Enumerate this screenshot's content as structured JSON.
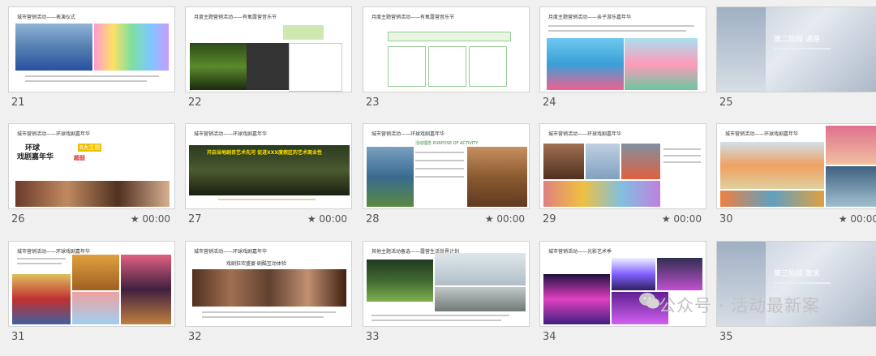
{
  "slides": [
    {
      "number": "21",
      "title": "城市营销活动——表演仪式",
      "duration": ""
    },
    {
      "number": "22",
      "title": "月度主题营销活动——有氧露营音乐节",
      "duration": ""
    },
    {
      "number": "23",
      "title": "月度主题营销活动——有氧露营音乐节",
      "duration": ""
    },
    {
      "number": "24",
      "title": "月度主题营销活动——亲子游乐嘉年华",
      "duration": ""
    },
    {
      "number": "25",
      "title": "第二阶段 通路",
      "duration": ""
    },
    {
      "number": "26",
      "title": "城市营销活动——环球戏剧嘉年华",
      "duration": "00:00"
    },
    {
      "number": "27",
      "title": "城市营销活动——环球戏剧嘉年华",
      "duration": "00:00"
    },
    {
      "number": "28",
      "title": "城市营销活动——环球戏剧嘉年华",
      "duration": "00:00"
    },
    {
      "number": "29",
      "title": "城市营销活动——环球戏剧嘉年华",
      "duration": "00:00"
    },
    {
      "number": "30",
      "title": "城市营销活动——环球戏剧嘉年华",
      "duration": "00:00"
    },
    {
      "number": "31",
      "title": "城市营销活动——环球戏剧嘉年华",
      "duration": ""
    },
    {
      "number": "32",
      "title": "城市营销活动——环球戏剧嘉年华",
      "duration": ""
    },
    {
      "number": "33",
      "title": "其他主题活动备选——露营生活世界计划",
      "duration": ""
    },
    {
      "number": "34",
      "title": "城市营销活动——光影艺术季",
      "duration": ""
    },
    {
      "number": "35",
      "title": "第三阶段 聚焦",
      "duration": ""
    }
  ],
  "slide26": {
    "headline1": "环球",
    "headline2": "戏剧嘉年华",
    "tag": "8大主题",
    "tag2": "超前"
  },
  "slide27": {
    "headline": "开启当地剧目艺术先河 促进XXX度假区的艺术商业性"
  },
  "slide28": {
    "subtitle": "活动理念 PURPOSE OF ACTIVITY"
  },
  "slide32": {
    "subtitle": "戏剧狂欢盛宴·剧酷互动体验"
  },
  "watermark": {
    "text": "公众号 · 活动最新案"
  },
  "star": "★"
}
